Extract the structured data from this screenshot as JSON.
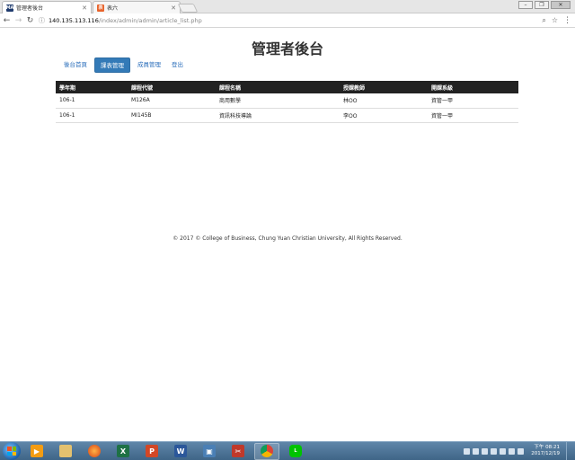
{
  "browser": {
    "tabs": [
      {
        "title": "管理者後台",
        "favicon": "MA",
        "active": true
      },
      {
        "title": "表六",
        "favicon": "表",
        "active": false
      }
    ],
    "url_host": "140.135.113.116",
    "url_path": "/index/admin/admin/article_list.php"
  },
  "page": {
    "title": "管理者後台",
    "nav": [
      {
        "label": "後台首頁",
        "active": false
      },
      {
        "label": "課表管理",
        "active": true
      },
      {
        "label": "成員管理",
        "active": false
      },
      {
        "label": "登出",
        "active": false
      }
    ],
    "table": {
      "headers": [
        "學年期",
        "課程代號",
        "課程名稱",
        "授課教師",
        "開課系級"
      ],
      "rows": [
        [
          "106-1",
          "M126A",
          "商用數學",
          "林OO",
          "資管一甲"
        ],
        [
          "106-1",
          "MI145B",
          "資訊科技導論",
          "李OO",
          "資管一甲"
        ]
      ]
    },
    "footer": "© 2017 © College of Business, Chung Yuan Christian University, All Rights Reserved."
  },
  "taskbar": {
    "clock_period": "下午 08:21",
    "clock_date": "2017/12/19"
  },
  "colors": {
    "nav_active": "#337ab7",
    "table_header": "#222222",
    "link": "#2a6ebb"
  }
}
